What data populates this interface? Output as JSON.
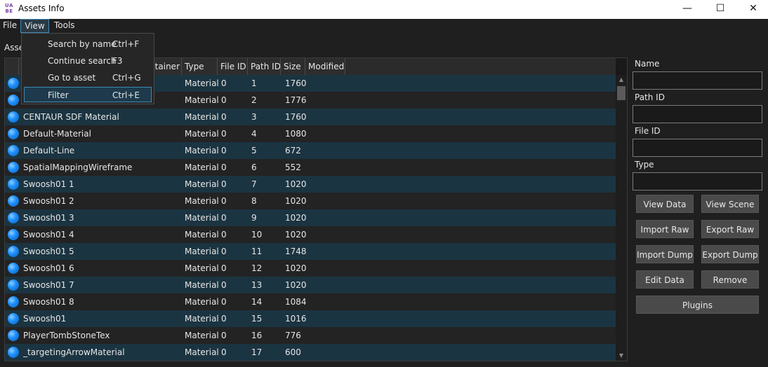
{
  "window": {
    "icon_text": "UABE",
    "title": "Assets Info",
    "minimize": "—",
    "maximize": "☐",
    "close": "✕"
  },
  "menu": {
    "file": "File",
    "view": "View",
    "tools": "Tools"
  },
  "view_menu": {
    "items": [
      {
        "label": "Search by name",
        "shortcut": "Ctrl+F"
      },
      {
        "label": "Continue search",
        "shortcut": "F3"
      },
      {
        "label": "Go to asset",
        "shortcut": "Ctrl+G"
      },
      {
        "label": "Filter",
        "shortcut": "Ctrl+E"
      }
    ]
  },
  "assets_label": "Asse",
  "table": {
    "columns": [
      "",
      "ntainer",
      "Type",
      "File ID",
      "Path ID",
      "Size",
      "Modified"
    ],
    "rows": [
      {
        "name": "",
        "type": "Material",
        "file_id": "0",
        "path_id": "1",
        "size": "1760"
      },
      {
        "name": "",
        "type": "Material",
        "file_id": "0",
        "path_id": "2",
        "size": "1776"
      },
      {
        "name": "CENTAUR SDF Material",
        "type": "Material",
        "file_id": "0",
        "path_id": "3",
        "size": "1760"
      },
      {
        "name": "Default-Material",
        "type": "Material",
        "file_id": "0",
        "path_id": "4",
        "size": "1080"
      },
      {
        "name": "Default-Line",
        "type": "Material",
        "file_id": "0",
        "path_id": "5",
        "size": "672"
      },
      {
        "name": "SpatialMappingWireframe",
        "type": "Material",
        "file_id": "0",
        "path_id": "6",
        "size": "552"
      },
      {
        "name": "Swoosh01 1",
        "type": "Material",
        "file_id": "0",
        "path_id": "7",
        "size": "1020"
      },
      {
        "name": "Swoosh01 2",
        "type": "Material",
        "file_id": "0",
        "path_id": "8",
        "size": "1020"
      },
      {
        "name": "Swoosh01 3",
        "type": "Material",
        "file_id": "0",
        "path_id": "9",
        "size": "1020"
      },
      {
        "name": "Swoosh01 4",
        "type": "Material",
        "file_id": "0",
        "path_id": "10",
        "size": "1020"
      },
      {
        "name": "Swoosh01 5",
        "type": "Material",
        "file_id": "0",
        "path_id": "11",
        "size": "1748"
      },
      {
        "name": "Swoosh01 6",
        "type": "Material",
        "file_id": "0",
        "path_id": "12",
        "size": "1020"
      },
      {
        "name": "Swoosh01 7",
        "type": "Material",
        "file_id": "0",
        "path_id": "13",
        "size": "1020"
      },
      {
        "name": "Swoosh01 8",
        "type": "Material",
        "file_id": "0",
        "path_id": "14",
        "size": "1084"
      },
      {
        "name": "Swoosh01",
        "type": "Material",
        "file_id": "0",
        "path_id": "15",
        "size": "1016"
      },
      {
        "name": "PlayerTombStoneTex",
        "type": "Material",
        "file_id": "0",
        "path_id": "16",
        "size": "776"
      },
      {
        "name": "_targetingArrowMaterial",
        "type": "Material",
        "file_id": "0",
        "path_id": "17",
        "size": "600"
      }
    ]
  },
  "side": {
    "name_label": "Name",
    "path_id_label": "Path ID",
    "file_id_label": "File ID",
    "type_label": "Type",
    "buttons": {
      "view_data": "View Data",
      "view_scene": "View Scene",
      "import_raw": "Import Raw",
      "export_raw": "Export Raw",
      "import_dump": "Import Dump",
      "export_dump": "Export Dump",
      "edit_data": "Edit Data",
      "remove": "Remove",
      "plugins": "Plugins"
    }
  },
  "colors": {
    "row_odd": "#1b3441",
    "row_even": "#232323",
    "accent": "#3f88b8"
  }
}
